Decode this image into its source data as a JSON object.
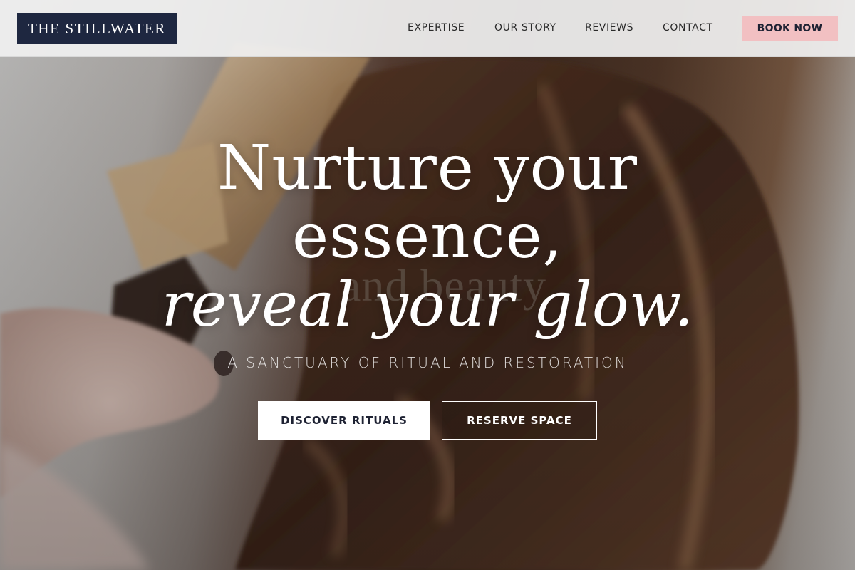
{
  "brand": {
    "logo_text": "THE STILLWATER"
  },
  "nav": {
    "items": [
      {
        "label": "EXPERTISE"
      },
      {
        "label": "OUR STORY"
      },
      {
        "label": "REVIEWS"
      },
      {
        "label": "CONTACT"
      }
    ],
    "cta_label": "BOOK NOW"
  },
  "hero": {
    "headline_line1": "Nurture your",
    "headline_line2": "essence,",
    "headline_line3": "reveal your glow.",
    "ghost_text": "and beauty",
    "tagline": "A SANCTUARY OF RITUAL AND RESTORATION",
    "primary_cta": "DISCOVER RITUALS",
    "secondary_cta": "RESERVE SPACE"
  },
  "colors": {
    "navy": "#1e2740",
    "blush": "#f2c0c2",
    "white": "#ffffff",
    "header_bg": "#f0f0f0"
  }
}
